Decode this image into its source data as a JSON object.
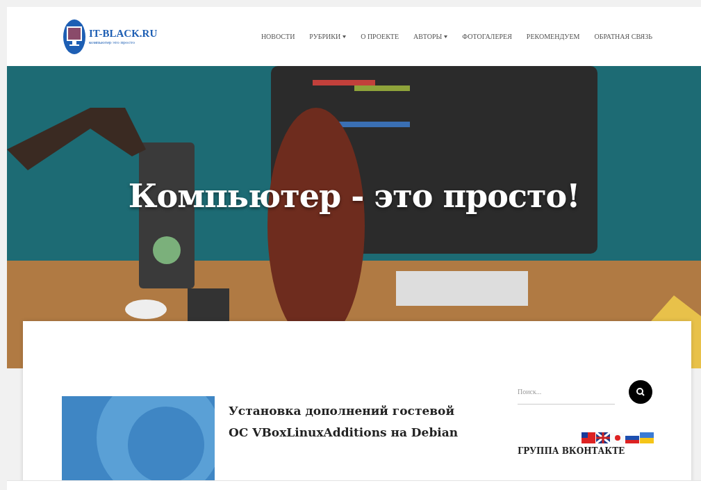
{
  "header": {
    "logo_title": "IT-BLACK.RU",
    "logo_tagline": "компьютер это просто",
    "nav": [
      {
        "label": "НОВОСТИ",
        "dropdown": false
      },
      {
        "label": "РУБРИКИ",
        "dropdown": true
      },
      {
        "label": "О ПРОЕКТЕ",
        "dropdown": false
      },
      {
        "label": "АВТОРЫ",
        "dropdown": true
      },
      {
        "label": "ФОТОГАЛЕРЕЯ",
        "dropdown": false
      },
      {
        "label": "РЕКОМЕНДУЕМ",
        "dropdown": false
      },
      {
        "label": "ОБРАТНАЯ СВЯЗЬ",
        "dropdown": false
      }
    ]
  },
  "hero": {
    "heading": "Компьютер - это просто!"
  },
  "post": {
    "title": "Установка дополнений гостевой ОС VBoxLinuxAdditions на Debian"
  },
  "sidebar": {
    "search": {
      "placeholder": "Поиск..."
    },
    "widget_title": "ГРУППА ВКОНТАКТЕ"
  }
}
